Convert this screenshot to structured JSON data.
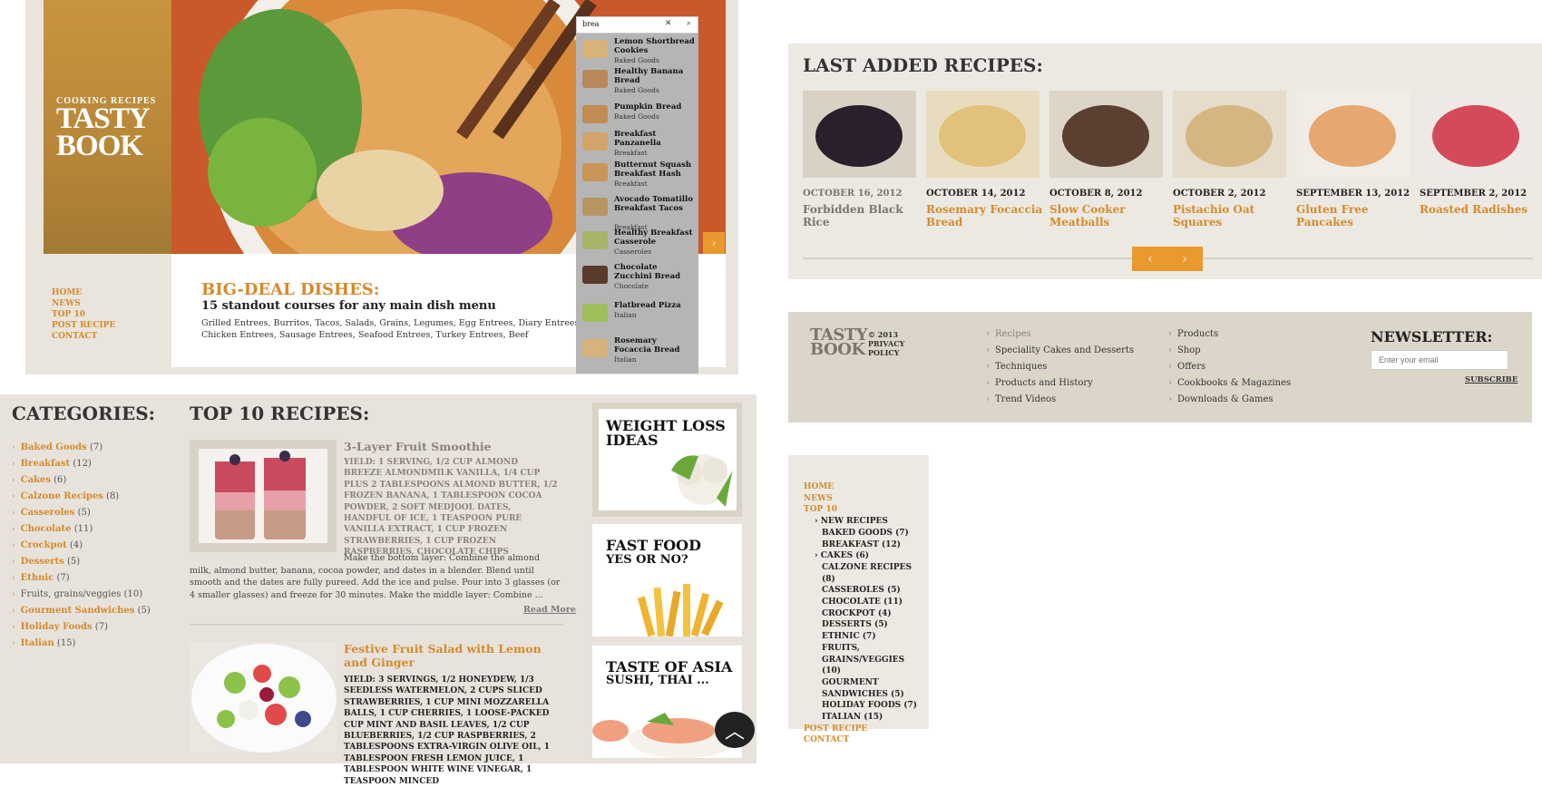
{
  "hero": {
    "logo_small": "COOKING RECIPES",
    "logo_big_1": "TASTY",
    "logo_big_2": "BOOK",
    "nav": [
      "HOME",
      "NEWS",
      "TOP 10",
      "POST RECIPE",
      "CONTACT"
    ],
    "title": "BIG-DEAL DISHES:",
    "subtitle": "15 standout courses for any main dish menu",
    "text": "Grilled Entrees, Burritos, Tacos, Salads, Grains, Legumes, Egg Entrees, Diary Entrees, Chicken Entrees, Sausage Entrees, Seafood Entrees, Turkey Entrees, Beef"
  },
  "search": {
    "value": "brea",
    "results": [
      {
        "name": "Lemon Shortbread Cookies",
        "category": "Baked Goods"
      },
      {
        "name": "Healthy Banana Bread",
        "category": "Baked Goods"
      },
      {
        "name": "Pumpkin Bread",
        "category": "Baked Goods"
      },
      {
        "name": "Breakfast Panzanella",
        "category": "Breakfast"
      },
      {
        "name": "Butternut Squash Breakfast Hash",
        "category": "Breakfast"
      },
      {
        "name": "Avocado Tomatillo Breakfast Tacos",
        "category": "Breakfast"
      },
      {
        "name": "Healthy Breakfast Casserole",
        "category": "Casseroles"
      },
      {
        "name": "Chocolate Zucchini Bread",
        "category": "Chocolate"
      },
      {
        "name": "Flatbread Pizza",
        "category": "Italian"
      },
      {
        "name": "Rosemary Focaccia Bread",
        "category": "Italian"
      }
    ]
  },
  "last_added": {
    "title": "LAST ADDED RECIPES:",
    "items": [
      {
        "date": "OCTOBER 16, 2012",
        "name": "Forbidden Black Rice"
      },
      {
        "date": "OCTOBER 14, 2012",
        "name": "Rosemary Focaccia Bread"
      },
      {
        "date": "OCTOBER 8, 2012",
        "name": "Slow Cooker Meatballs"
      },
      {
        "date": "OCTOBER 2, 2012",
        "name": "Pistachio Oat Squares"
      },
      {
        "date": "SEPTEMBER 13, 2012",
        "name": "Gluten Free Pancakes"
      },
      {
        "date": "SEPTEMBER 2, 2012",
        "name": "Roasted Radishes"
      }
    ],
    "prev": "‹",
    "next": "›"
  },
  "footer": {
    "logo_1": "TASTY",
    "logo_2": "BOOK",
    "copyright": "© 2013 PRIVACY POLICY",
    "col1": [
      "Recipes",
      "Speciality Cakes and Desserts",
      "Techniques",
      "Products and History",
      "Trend Videos"
    ],
    "col2": [
      "Products",
      "Shop",
      "Offers",
      "Cookbooks & Magazines",
      "Downloads & Games"
    ],
    "newsletter_title": "NEWSLETTER:",
    "newsletter_placeholder": "Enter your email",
    "subscribe": "SUBSCRIBE"
  },
  "sidemenu": {
    "top": [
      "HOME",
      "NEWS",
      "TOP 10"
    ],
    "sub": [
      "NEW RECIPES",
      "BAKED GOODS (7)",
      "BREAKFAST (12)",
      "CAKES (6)",
      "CALZONE RECIPES (8)",
      "CASSEROLES (5)",
      "CHOCOLATE (11)",
      "CROCKPOT (4)",
      "DESSERTS (5)",
      "ETHNIC (7)",
      "FRUITS, GRAINS/VEGGIES (10)",
      "GOURMENT SANDWICHES (5)",
      "HOLIDAY FOODS (7)",
      "ITALIAN (15)"
    ],
    "bottom": [
      "POST RECIPE",
      "CONTACT"
    ]
  },
  "categories": {
    "title": "CATEGORIES:",
    "items": [
      {
        "name": "Baked Goods",
        "count": "(7)"
      },
      {
        "name": "Breakfast",
        "count": "(12)"
      },
      {
        "name": "Cakes",
        "count": "(6)"
      },
      {
        "name": "Calzone Recipes",
        "count": "(8)"
      },
      {
        "name": "Casseroles",
        "count": "(5)"
      },
      {
        "name": "Chocolate",
        "count": "(11)"
      },
      {
        "name": "Crockpot",
        "count": "(4)"
      },
      {
        "name": "Desserts",
        "count": "(5)"
      },
      {
        "name": "Ethnic",
        "count": "(7)"
      },
      {
        "name": "Fruits, grains/veggies",
        "count": "(10)"
      },
      {
        "name": "Gourment Sandwiches",
        "count": "(5)"
      },
      {
        "name": "Holiday Foods",
        "count": "(7)"
      },
      {
        "name": "Italian",
        "count": "(15)"
      }
    ]
  },
  "top10": {
    "title": "TOP 10 RECIPES:",
    "r1_name": "3-Layer Fruit Smoothie",
    "r1_yield": "YIELD: 1 SERVING, 1/2 CUP ALMOND BREEZE ALMONDMILK VANILLA, 1/4 CUP PLUS 2 TABLESPOONS ALMOND BUTTER, 1/2 FROZEN BANANA, 1 TABLESPOON COCOA POWDER, 2 SOFT MEDJOOL DATES, HANDFUL OF ICE, 1 TEASPOON PURE VANILLA EXTRACT, 1 CUP FROZEN STRAWBERRIES, 1 CUP FROZEN RASPBERRIES, CHOCOLATE CHIPS",
    "r1_body": "Make the bottom layer: Combine the almond milk, almond butter, banana, cocoa powder, and dates in a blender. Blend until smooth and the dates are fully pureed. Add the ice and pulse. Pour into 3 glasses (or 4 smaller glasses) and freeze for 30 minutes. Make the middle layer: Combine ...",
    "read_more": "Read More",
    "r2_name": "Festive Fruit Salad with Lemon and Ginger",
    "r2_yield": "YIELD: 3 SERVINGS, 1/2 HONEYDEW, 1/3 SEEDLESS WATERMELON, 2 CUPS SLICED STRAWBERRIES, 1 CUP MINI MOZZARELLA BALLS, 1 CUP CHERRIES, 1 LOOSE-PACKED CUP MINT AND BASIL LEAVES, 1/2 CUP BLUEBERRIES, 1/2 CUP RASPBERRIES, 2 TABLESPOONS EXTRA-VIRGIN OLIVE OIL, 1 TABLESPOON FRESH LEMON JUICE, 1 TABLESPOON WHITE WINE VINEGAR, 1 TEASPOON MINCED"
  },
  "ads": [
    {
      "line1": "WEIGHT LOSS",
      "line2": "IDEAS"
    },
    {
      "line1": "FAST FOOD",
      "line2": "YES OR NO?"
    },
    {
      "line1": "TASTE OF ASIA",
      "line2": "SUSHI, THAI ..."
    }
  ]
}
